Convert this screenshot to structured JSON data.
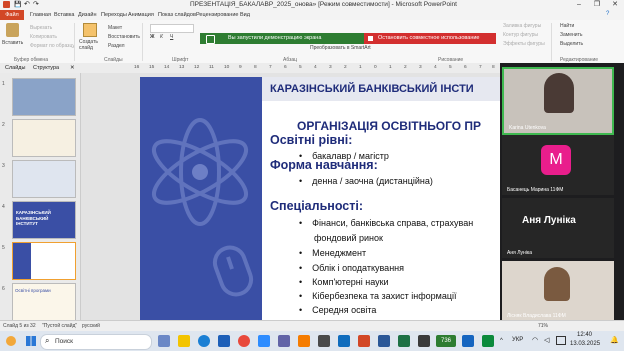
{
  "window": {
    "title": "ПРЕЗЕНТАЦІЯ_БАКАЛАВР_2025_онова» [Режим совместимости] - Microsoft PowerPoint",
    "min": "–",
    "max": "❐",
    "close": "✕"
  },
  "menu": [
    "Файл",
    "Главная",
    "Вставка",
    "Дизайн",
    "Переходы",
    "Анимация",
    "Показ слайдов",
    "Рецензирование",
    "Вид"
  ],
  "ribbon": {
    "paste": "Вставить",
    "cut": "Вырезать",
    "copy": "Копировать",
    "format_painter": "Формат по образцу",
    "new_slide": "Создать слайд",
    "layout": "Макет",
    "reset": "Восстановить",
    "section": "Раздел",
    "find": "Найти",
    "replace": "Заменить",
    "select": "Выделить",
    "shape_fill": "Заливка фигуры",
    "shape_outline": "Контур фигуры",
    "shape_effects": "Эффекты фигуры",
    "smartart": "Преобразовать в SmartArt",
    "groups": {
      "clipboard": "Буфер обмена",
      "slides": "Слайды",
      "font": "Шрифт",
      "paragraph": "Абзац",
      "drawing": "Рисование",
      "editing": "Редактирование"
    }
  },
  "notification": {
    "message": "Вы запустили демонстрацию экрана",
    "stop": "Остановить совместное использование"
  },
  "panes": {
    "slides_tab": "Слайды",
    "outline_tab": "Структура"
  },
  "ruler": [
    "16",
    "15",
    "14",
    "13",
    "12",
    "11",
    "10",
    "9",
    "8",
    "7",
    "6",
    "5",
    "4",
    "3",
    "2",
    "1",
    "0",
    "1",
    "2",
    "3",
    "4",
    "5",
    "6",
    "7",
    "8"
  ],
  "thumbs": {
    "numbers": [
      "1",
      "2",
      "3",
      "4",
      "5",
      "6"
    ],
    "slide4_text": "КАРАЗІНСЬКИЙ БАНКІВСЬКИЙ ІНСТИТУТ",
    "slide6_text": "Освітні програми"
  },
  "slide": {
    "header": "КАРАЗІНСЬКИЙ БАНКІВСЬКИЙ ІНСТИ",
    "title": "ОРГАНІЗАЦІЯ ОСВІТНЬОГО ПР",
    "h_levels": "Освітні рівні:",
    "b_levels": "бакалавр / магістр",
    "h_forms": "Форма навчання:",
    "b_forms": "денна / заочна (дистанційна)",
    "h_specs": "Спеціальності:",
    "specs": [
      "Фінанси, банківська справа, страхуван",
      "фондовий ринок",
      "Менеджмент",
      "Облік і оподаткування",
      "Комп'ютерні науки",
      "Кібербезпека та захист інформації",
      "Середня освіта"
    ]
  },
  "participants": [
    {
      "name": "Karina Utenkova"
    },
    {
      "name": "Басанець Марина 11ФМ",
      "initial": "M"
    },
    {
      "name": "Аня Луніка",
      "big": "Аня Луніка"
    },
    {
      "name": "Лісняк Владислава 11ФМ"
    }
  ],
  "status": {
    "slide": "Слайд 5 из 32",
    "theme": "\"Пустой слайд\"",
    "lang": "русский",
    "zoom": "71%"
  },
  "taskbar": {
    "search": "Поиск",
    "lang": "УКР",
    "time": "12:40",
    "date": "13.03.2025",
    "badge": "736"
  },
  "colors": {
    "accent": "#3a4fa5",
    "file": "#d24726",
    "notif_green": "#2e7d32",
    "notif_red": "#d32f2f",
    "avatar_pink": "#e91e8c"
  }
}
